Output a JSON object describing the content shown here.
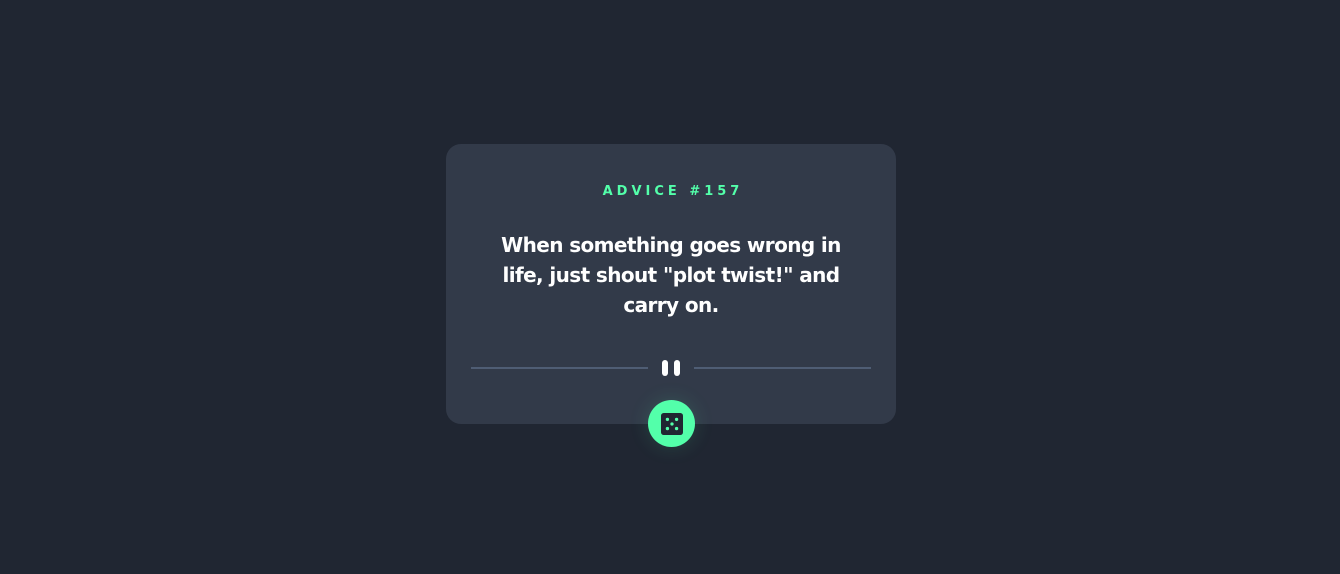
{
  "advice": {
    "id_label": "ADVICE #157",
    "text": "When something goes wrong in life, just shout \"plot twist!\" and carry on."
  },
  "icons": {
    "divider": "pause-icon",
    "button": "dice-icon"
  },
  "colors": {
    "background": "#202632",
    "card": "#323a49",
    "accent": "#53ffaa",
    "text": "#ffffff",
    "divider": "#4f5d74"
  }
}
